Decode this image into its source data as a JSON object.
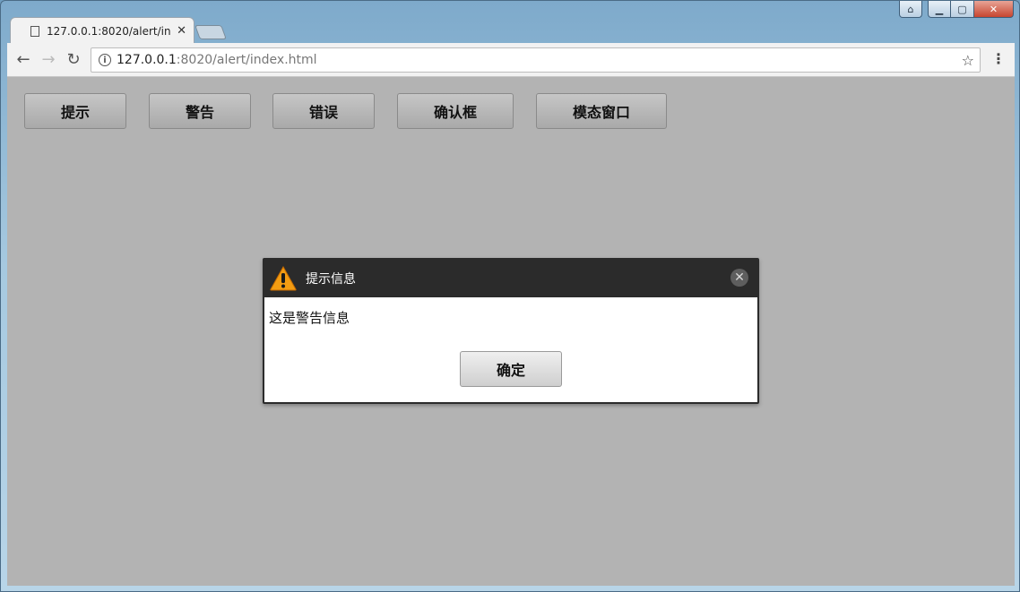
{
  "browser": {
    "tab": {
      "title": "127.0.0.1:8020/alert/in",
      "close": "✕"
    },
    "url": {
      "host": "127.0.0.1",
      "rest": ":8020/alert/index.html"
    }
  },
  "page": {
    "buttons": [
      {
        "label": "提示"
      },
      {
        "label": "警告"
      },
      {
        "label": "错误"
      },
      {
        "label": "确认框"
      },
      {
        "label": "模态窗口"
      }
    ]
  },
  "dialog": {
    "title": "提示信息",
    "message": "这是警告信息",
    "ok_label": "确定",
    "close_icon": "close-icon",
    "title_icon": "warning-icon"
  },
  "colors": {
    "page_background": "#b3b3b3",
    "dialog_header": "#2b2b2b",
    "warning_orange": "#f39c12"
  }
}
